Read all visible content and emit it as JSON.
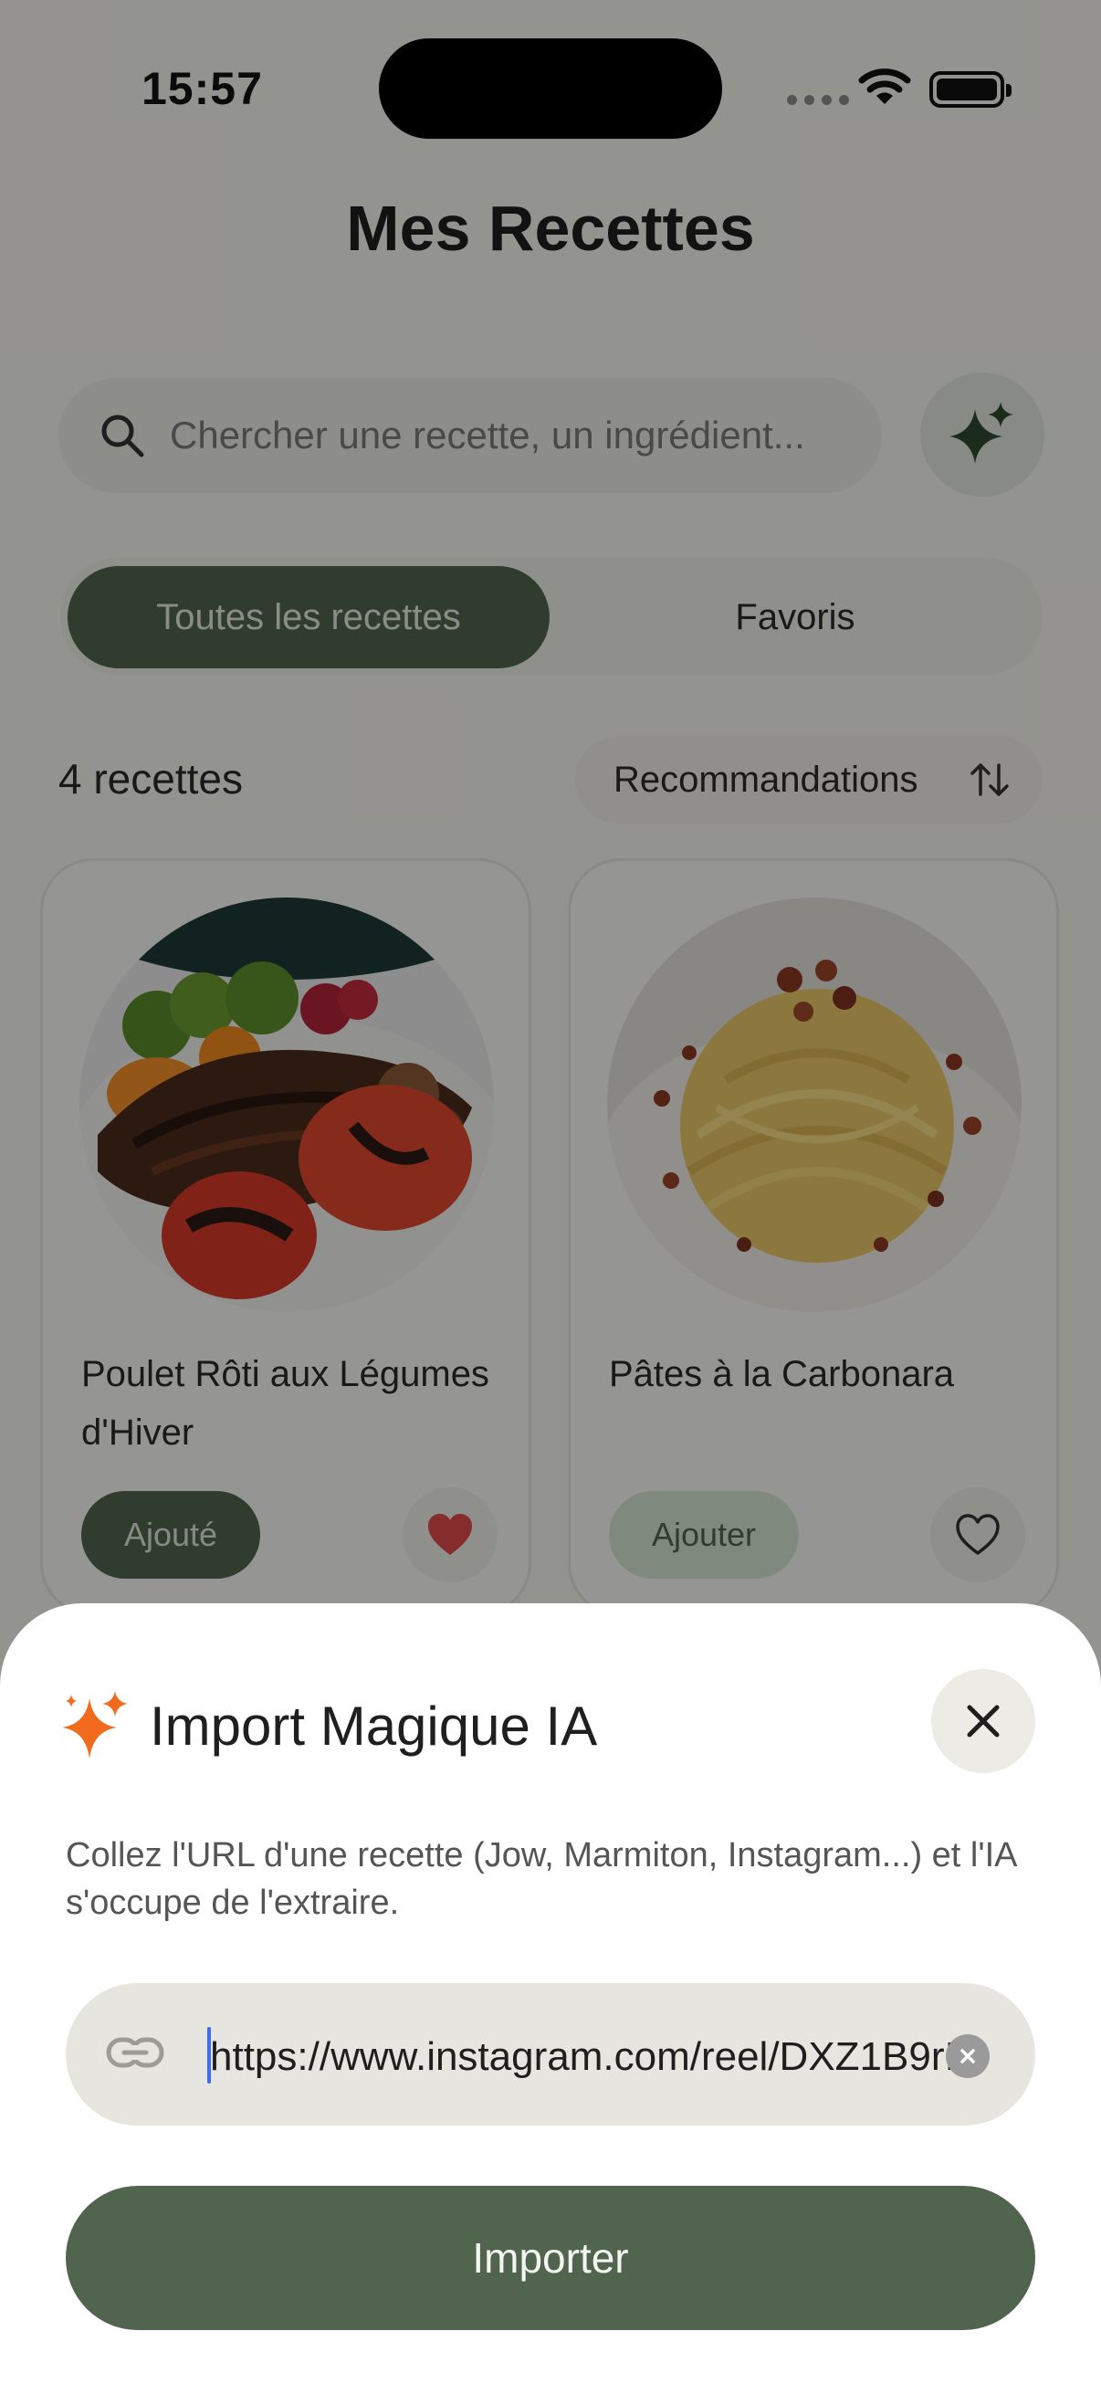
{
  "status_bar": {
    "time": "15:57"
  },
  "header": {
    "title": "Mes Recettes"
  },
  "search": {
    "placeholder": "Chercher une recette, un ingrédient..."
  },
  "tabs": [
    {
      "label": "Toutes les recettes",
      "active": true
    },
    {
      "label": "Favoris",
      "active": false
    }
  ],
  "list_bar": {
    "count": "4 recettes",
    "sort_label": "Recommandations"
  },
  "recipes": [
    {
      "title": "Poulet Rôti aux Légumes d'Hiver",
      "button": "Ajouté",
      "favorite": true
    },
    {
      "title": "Pâtes à la Carbonara",
      "button": "Ajouter",
      "favorite": false
    }
  ],
  "sheet": {
    "title": "Import Magique IA",
    "description": "Collez l'URL d'une recette (Jow, Marmiton, Instagram...) et l'IA s'occupe de l'extraire.",
    "url_value": "https://www.instagram.com/reel/DXZ1B9rI",
    "import_label": "Importer"
  },
  "colors": {
    "primary_green": "#51644e",
    "light_green": "#d6e5d3",
    "sparkle_orange": "#f26a1b",
    "heart_red": "#e04a4a"
  }
}
